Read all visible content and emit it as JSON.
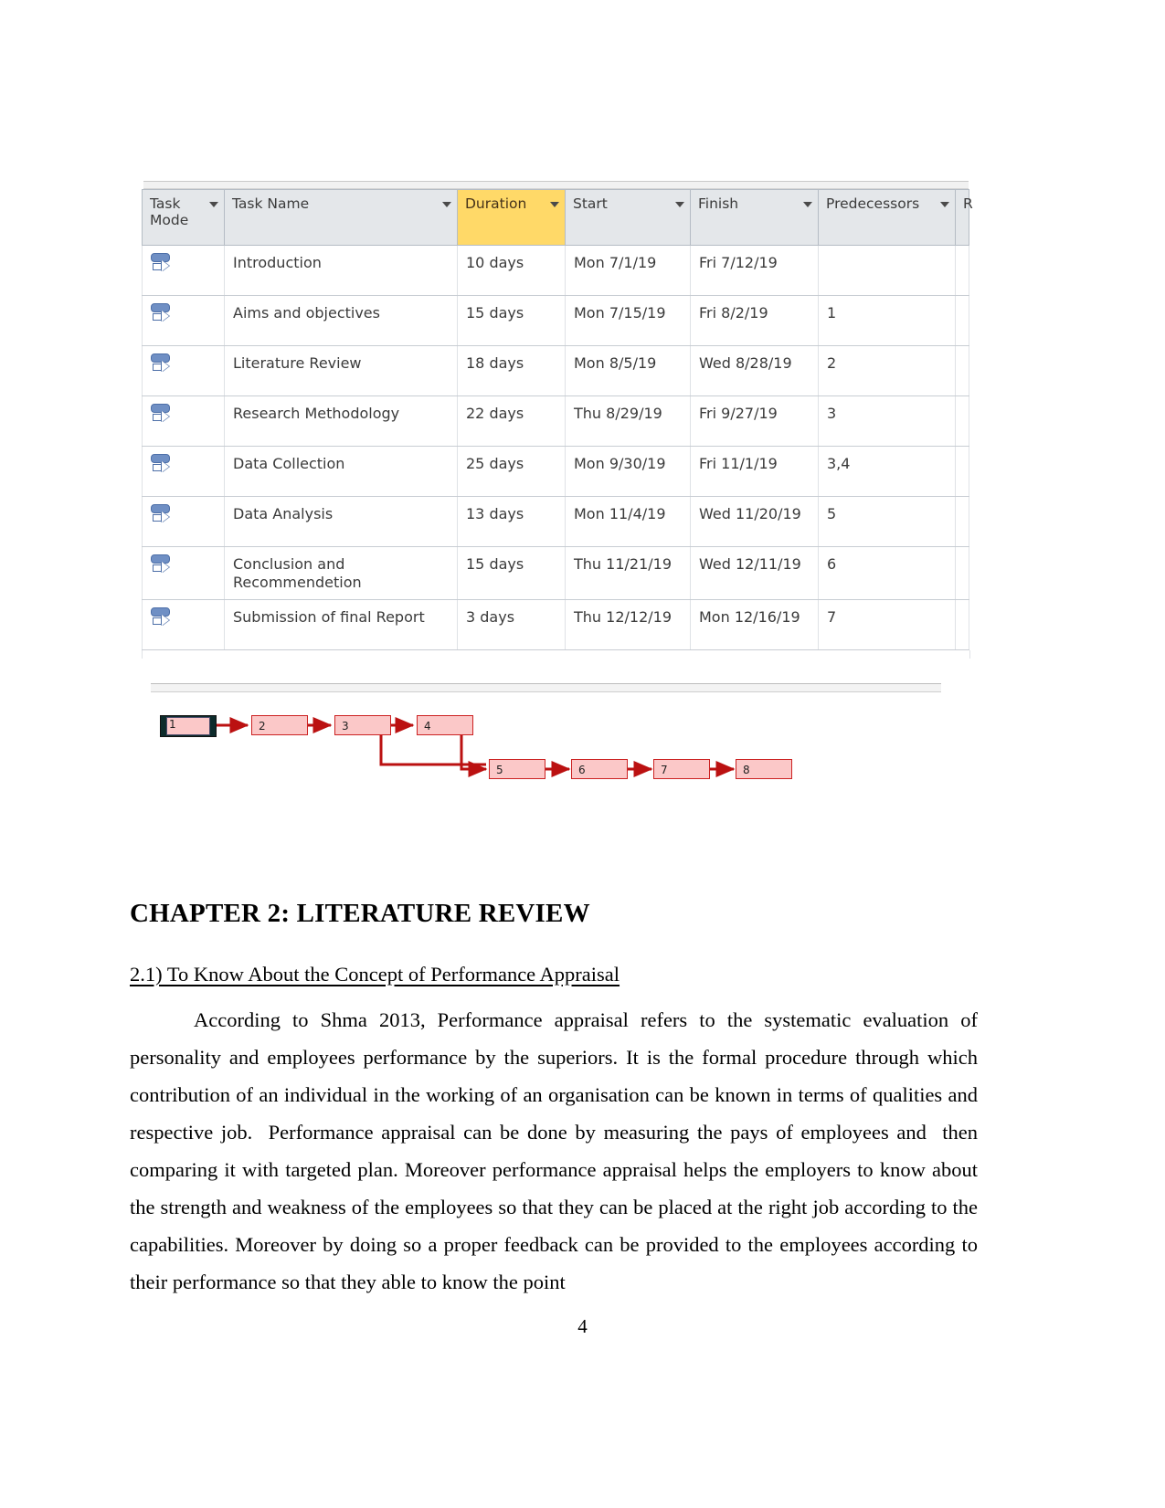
{
  "project_table": {
    "columns": [
      {
        "key": "task_mode",
        "label": "Task Mode",
        "highlight": false,
        "has_filter": true
      },
      {
        "key": "task_name",
        "label": "Task Name",
        "highlight": false,
        "has_filter": true
      },
      {
        "key": "duration",
        "label": "Duration",
        "highlight": true,
        "has_filter": true
      },
      {
        "key": "start",
        "label": "Start",
        "highlight": false,
        "has_filter": true
      },
      {
        "key": "finish",
        "label": "Finish",
        "highlight": false,
        "has_filter": true
      },
      {
        "key": "predecessors",
        "label": "Predecessors",
        "highlight": false,
        "has_filter": true
      },
      {
        "key": "partial",
        "label": "R",
        "highlight": false,
        "has_filter": false
      }
    ],
    "mode_icon": "auto-schedule-icon",
    "rows": [
      {
        "mode": "auto-schedule-icon",
        "name": "Introduction",
        "duration": "10 days",
        "start": "Mon 7/1/19",
        "finish": "Fri 7/12/19",
        "predecessors": ""
      },
      {
        "mode": "auto-schedule-icon",
        "name": "Aims and objectives",
        "duration": "15 days",
        "start": "Mon 7/15/19",
        "finish": "Fri 8/2/19",
        "predecessors": "1"
      },
      {
        "mode": "auto-schedule-icon",
        "name": "Literature Review",
        "duration": "18 days",
        "start": "Mon 8/5/19",
        "finish": "Wed 8/28/19",
        "predecessors": "2"
      },
      {
        "mode": "auto-schedule-icon",
        "name": "Research Methodology",
        "duration": "22 days",
        "start": "Thu 8/29/19",
        "finish": "Fri 9/27/19",
        "predecessors": "3"
      },
      {
        "mode": "auto-schedule-icon",
        "name": "Data Collection",
        "duration": "25 days",
        "start": "Mon 9/30/19",
        "finish": "Fri 11/1/19",
        "predecessors": "3,4"
      },
      {
        "mode": "auto-schedule-icon",
        "name": "Data Analysis",
        "duration": "13 days",
        "start": "Mon 11/4/19",
        "finish": "Wed 11/20/19",
        "predecessors": "5"
      },
      {
        "mode": "auto-schedule-icon",
        "name": "Conclusion and Recommendetion",
        "duration": "15 days",
        "start": "Thu 11/21/19",
        "finish": "Wed 12/11/19",
        "predecessors": "6"
      },
      {
        "mode": "auto-schedule-icon",
        "name": "Submission of final Report",
        "duration": "3 days",
        "start": "Thu 12/12/19",
        "finish": "Mon 12/16/19",
        "predecessors": "7"
      }
    ]
  },
  "network_diagram": {
    "node_fill": "#fbc8c8",
    "node_border": "#cc2222",
    "link_color": "#bb1111",
    "nodes": [
      {
        "id": "1",
        "label": "1",
        "selected": true
      },
      {
        "id": "2",
        "label": "2",
        "selected": false
      },
      {
        "id": "3",
        "label": "3",
        "selected": false
      },
      {
        "id": "4",
        "label": "4",
        "selected": false
      },
      {
        "id": "5",
        "label": "5",
        "selected": false
      },
      {
        "id": "6",
        "label": "6",
        "selected": false
      },
      {
        "id": "7",
        "label": "7",
        "selected": false
      },
      {
        "id": "8",
        "label": "8",
        "selected": false
      }
    ],
    "links": [
      {
        "from": "1",
        "to": "2"
      },
      {
        "from": "2",
        "to": "3"
      },
      {
        "from": "3",
        "to": "4"
      },
      {
        "from": "3",
        "to": "5"
      },
      {
        "from": "4",
        "to": "5"
      },
      {
        "from": "5",
        "to": "6"
      },
      {
        "from": "6",
        "to": "7"
      },
      {
        "from": "7",
        "to": "8"
      }
    ]
  },
  "document": {
    "chapter_title": "CHAPTER 2: LITERATURE REVIEW",
    "subheading": "2.1) To Know About the Concept of Performance Appraisal",
    "paragraph": "According to Shma 2013, Performance appraisal refers to the systematic evaluation of personality and employees performance by the superiors. It is the formal procedure through which contribution of an individual in the working of an organisation can be known in terms of qualities and respective job.  Performance appraisal can be done by measuring the pays of employees and  then comparing it with targeted plan. Moreover performance appraisal helps the employers to know about the strength and weakness of the employees so that they can be placed at the right job according to the capabilities. Moreover by doing so a proper feedback can be provided to the employees according to their performance so that they able to know the point",
    "page_number": "4"
  }
}
